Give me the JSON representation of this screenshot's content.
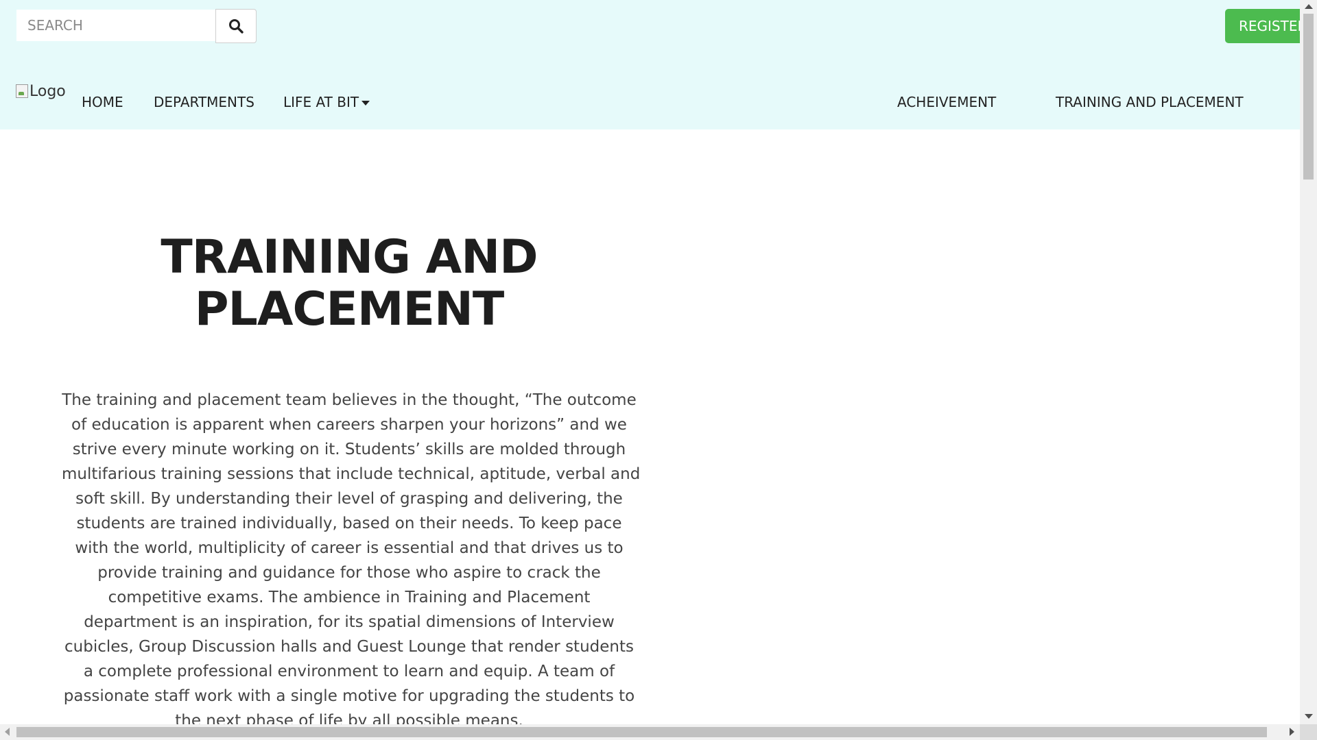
{
  "header": {
    "search": {
      "placeholder": "SEARCH",
      "value": ""
    },
    "register_label": "REGISTER",
    "logo_alt": "Logo"
  },
  "nav": {
    "home": "HOME",
    "departments": "DEPARTMENTS",
    "life_at_bit": "LIFE AT BIT",
    "acheivement": "ACHEIVEMENT",
    "training_and_placement": "TRAINING AND PLACEMENT"
  },
  "main": {
    "heading_lines": [
      "TRAINING AND",
      "PLACEMENT"
    ],
    "paragraph_lines": [
      "The training and placement team believes in the thought, “The outcome",
      "of education is apparent when careers sharpen your horizons” and we",
      "strive every minute working on it. Students’ skills are molded through",
      "multifarious training sessions that include technical, aptitude, verbal and",
      "soft skill. By understanding their level of grasping and delivering, the",
      "students are trained individually, based on their needs. To keep pace",
      "with the world, multiplicity of career is essential and that drives us to",
      "provide training and guidance for those who aspire to crack the",
      "competitive exams. The ambience in Training and Placement",
      "department is an inspiration, for its spatial dimensions of Interview",
      "cubicles, Group Discussion halls and Guest Lounge that render students",
      "a complete professional environment to learn and equip. A team of",
      "passionate staff work with a single motive for upgrading the students to",
      "the next phase of life by all possible means."
    ]
  },
  "colors": {
    "header_bg": "#e6fafa",
    "register_bg": "#4cbb4f",
    "heading": "#1e1e1e",
    "body_text": "#444444"
  },
  "icons": {
    "search": "search-icon",
    "dropdown": "caret-down-icon",
    "logo": "broken-image-icon"
  }
}
